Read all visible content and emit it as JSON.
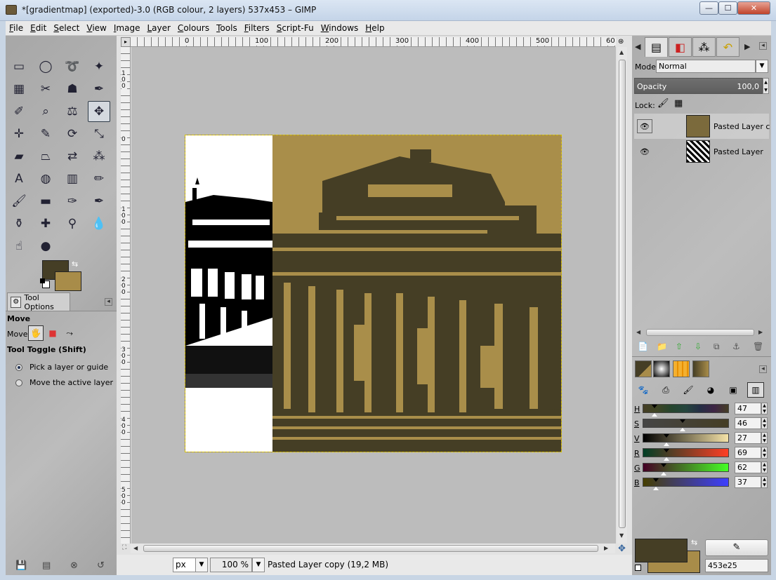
{
  "window": {
    "title": "*[gradientmap] (exported)-3.0 (RGB colour, 2 layers) 537x453 – GIMP",
    "min": "—",
    "max": "☐",
    "close": "✕"
  },
  "menu": [
    "File",
    "Edit",
    "Select",
    "View",
    "Image",
    "Layer",
    "Colours",
    "Tools",
    "Filters",
    "Script-Fu",
    "Windows",
    "Help"
  ],
  "toolbox": {
    "tools": [
      {
        "name": "rect-select-icon",
        "glyph": "▭"
      },
      {
        "name": "ellipse-select-icon",
        "glyph": "◯"
      },
      {
        "name": "free-select-icon",
        "glyph": "➰"
      },
      {
        "name": "fuzzy-select-icon",
        "glyph": "✦"
      },
      {
        "name": "select-by-color-icon",
        "glyph": "▦"
      },
      {
        "name": "scissors-icon",
        "glyph": "✂"
      },
      {
        "name": "foreground-select-icon",
        "glyph": "☗"
      },
      {
        "name": "paths-icon",
        "glyph": "✒"
      },
      {
        "name": "color-picker-icon",
        "glyph": "✐"
      },
      {
        "name": "zoom-icon",
        "glyph": "⌕"
      },
      {
        "name": "measure-icon",
        "glyph": "⚖"
      },
      {
        "name": "move-icon",
        "glyph": "✥"
      },
      {
        "name": "align-icon",
        "glyph": "✛"
      },
      {
        "name": "crop-icon",
        "glyph": "✎"
      },
      {
        "name": "rotate-icon",
        "glyph": "⟳"
      },
      {
        "name": "scale-icon",
        "glyph": "⤡"
      },
      {
        "name": "shear-icon",
        "glyph": "▰"
      },
      {
        "name": "perspective-icon",
        "glyph": "⏢"
      },
      {
        "name": "flip-icon",
        "glyph": "⇄"
      },
      {
        "name": "cage-transform-icon",
        "glyph": "⁂"
      },
      {
        "name": "text-icon",
        "glyph": "A"
      },
      {
        "name": "bucket-fill-icon",
        "glyph": "◍"
      },
      {
        "name": "blend-icon",
        "glyph": "▥"
      },
      {
        "name": "pencil-icon",
        "glyph": "✏"
      },
      {
        "name": "paintbrush-icon",
        "glyph": "🖌"
      },
      {
        "name": "eraser-icon",
        "glyph": "▬"
      },
      {
        "name": "airbrush-icon",
        "glyph": "✑"
      },
      {
        "name": "ink-icon",
        "glyph": "✒"
      },
      {
        "name": "clone-icon",
        "glyph": "⚱"
      },
      {
        "name": "heal-icon",
        "glyph": "✚"
      },
      {
        "name": "perspective-clone-icon",
        "glyph": "⚲"
      },
      {
        "name": "blur-icon",
        "glyph": "💧"
      },
      {
        "name": "smudge-icon",
        "glyph": "☝"
      },
      {
        "name": "dodge-burn-icon",
        "glyph": "●"
      }
    ],
    "fg_color": "#453e25",
    "bg_color": "#a88c49"
  },
  "tool_options": {
    "tab_label": "Tool Options",
    "title": "Move",
    "move_label": "Move:",
    "toggle_label": "Tool Toggle  (Shift)",
    "options": [
      "Pick a layer or guide",
      "Move the active layer"
    ]
  },
  "canvas": {
    "hruler_labels": [
      "0",
      "100",
      "200",
      "300",
      "400",
      "500",
      "60"
    ],
    "vruler_labels": [
      "100",
      "0",
      "100",
      "200",
      "300",
      "400",
      "500"
    ],
    "status": {
      "unit": "px",
      "zoom": "100 %",
      "text": "Pasted Layer copy (19,2 MB)"
    }
  },
  "layers": {
    "mode_label": "Mode:",
    "mode_value": "Normal",
    "opacity_label": "Opacity",
    "opacity_value": "100,0",
    "lock_label": "Lock:",
    "items": [
      {
        "name": "Pasted Layer copy",
        "selected": true
      },
      {
        "name": "Pasted Layer",
        "selected": false
      }
    ]
  },
  "colors": {
    "channels": [
      {
        "label": "H",
        "value": "47",
        "level": 0.13
      },
      {
        "label": "S",
        "value": "46",
        "level": 0.46
      },
      {
        "label": "V",
        "value": "27",
        "level": 0.27
      },
      {
        "label": "R",
        "value": "69",
        "level": 0.27
      },
      {
        "label": "G",
        "value": "62",
        "level": 0.24
      },
      {
        "label": "B",
        "value": "37",
        "level": 0.15
      }
    ],
    "hex": "453e25",
    "accent_fg": "#453e25",
    "accent_bg": "#a88c49"
  }
}
